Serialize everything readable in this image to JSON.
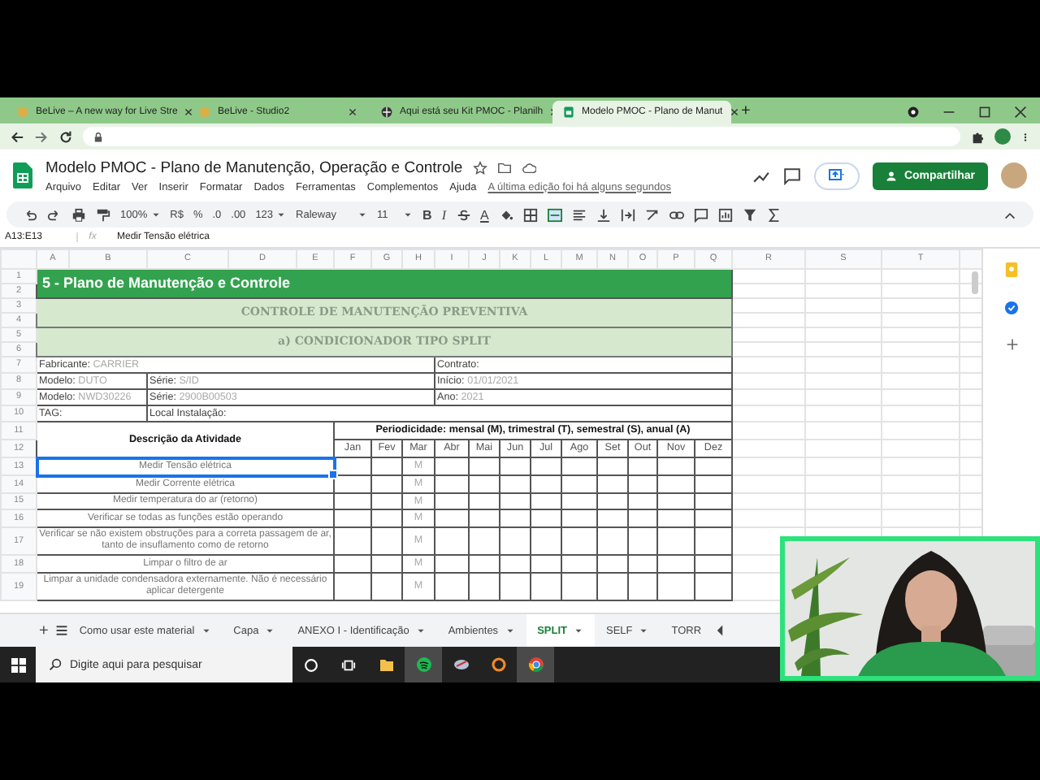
{
  "browser": {
    "tabs": [
      {
        "title": "BeLive – A new way for Live Stre",
        "selected": false
      },
      {
        "title": "BeLive - Studio2",
        "selected": false
      },
      {
        "title": "Aqui está seu Kit PMOC - Planilh",
        "selected": false
      },
      {
        "title": "Modelo PMOC - Plano de Manut",
        "selected": true
      }
    ],
    "new_tab": "+"
  },
  "app": {
    "title": "Modelo PMOC - Plano de Manutenção, Operação e Controle",
    "menu": [
      "Arquivo",
      "Editar",
      "Ver",
      "Inserir",
      "Formatar",
      "Dados",
      "Ferramentas",
      "Complementos",
      "Ajuda"
    ],
    "last_edit": "A última edição foi há alguns segundos",
    "share_button": "Compartilhar"
  },
  "toolbar": {
    "zoom": "100%",
    "currency": "R$",
    "percent": "%",
    "decimal_less": ".0",
    "decimal_more": ".00",
    "number_format": "123",
    "font": "Raleway",
    "font_size": "11",
    "bold": "B",
    "italic": "I",
    "text_color": "A"
  },
  "formula_bar": {
    "range": "A13:E13",
    "fx": "fx",
    "content": "Medir Tensão elétrica"
  },
  "columns": [
    "A",
    "B",
    "C",
    "D",
    "E",
    "F",
    "G",
    "H",
    "I",
    "J",
    "K",
    "L",
    "M",
    "N",
    "O",
    "P",
    "Q",
    "R",
    "S",
    "T"
  ],
  "row_numbers": [
    "1",
    "2",
    "3",
    "4",
    "5",
    "6",
    "7",
    "8",
    "9",
    "10",
    "11",
    "12",
    "13",
    "14",
    "15",
    "16",
    "17",
    "18",
    "19"
  ],
  "sheet": {
    "title": "5 - Plano de Manutenção e Controle",
    "subtitle": "CONTROLE DE MANUTENÇÃO PREVENTIVA",
    "section": "a) CONDICIONADOR TIPO SPLIT",
    "info_rows": [
      [
        {
          "label": "Fabricante:",
          "value": "CARRIER"
        },
        {
          "label": "Contrato:"
        }
      ],
      [
        {
          "label": "Modelo:",
          "value": "DUTO"
        },
        {
          "label": "Série:",
          "value": "S/ID"
        },
        {
          "label": "Início:",
          "value": "01/01/2021"
        }
      ],
      [
        {
          "label": "Modelo:",
          "value": "NWD30226"
        },
        {
          "label": "Série:",
          "value": "2900B00503"
        },
        {
          "label": "Ano:",
          "value": "2021"
        }
      ],
      [
        {
          "label": "TAG:"
        },
        {
          "label": "Local Instalação:"
        }
      ]
    ],
    "activity_header": "Descrição da Atividade",
    "periodicity": "Periodicidade: mensal (M), trimestral (T), semestral (S), anual (A)",
    "months": [
      {
        "label": "Jan"
      },
      {
        "label": "Fev"
      },
      {
        "label": "Mar",
        "marks": [
          "M",
          "M",
          "M",
          "M",
          "M",
          "M",
          "M"
        ]
      },
      {
        "label": "Abr"
      },
      {
        "label": "Mai"
      },
      {
        "label": "Jun"
      },
      {
        "label": "Jul"
      },
      {
        "label": "Ago"
      },
      {
        "label": "Set"
      },
      {
        "label": "Out"
      },
      {
        "label": "Nov"
      },
      {
        "label": "Dez"
      }
    ],
    "activities": [
      {
        "text": "Medir Tensão elétrica",
        "selected": true
      },
      {
        "text": "Medir Corrente elétrica",
        "selected": false
      },
      {
        "text": "Medir temperatura do ar (retorno)",
        "selected": false
      },
      {
        "text": "Verificar se todas as funções estão operando",
        "selected": false
      },
      {
        "text": "Verificar se não existem obstruções para a correta passagem de ar, tanto de insuflamento como de retorno",
        "selected": false
      },
      {
        "text": "Limpar o filtro de ar",
        "selected": false
      },
      {
        "text": "Limpar a unidade condensadora externamente. Não é necessário aplicar detergente",
        "selected": false
      }
    ]
  },
  "sheet_tabs_bar": {
    "add_button": "+"
  },
  "sheet_tabs": [
    {
      "label": "Como usar este material",
      "selected": false,
      "menu_caret": true
    },
    {
      "label": "Capa",
      "selected": false,
      "menu_caret": true
    },
    {
      "label": "ANEXO I - Identificação",
      "selected": false,
      "menu_caret": true
    },
    {
      "label": "Ambientes",
      "selected": false,
      "menu_caret": true
    },
    {
      "label": "SPLIT",
      "selected": true,
      "menu_caret": true
    },
    {
      "label": "SELF",
      "selected": false,
      "menu_caret": true
    },
    {
      "label": "TORR",
      "selected": false,
      "menu_caret": false
    }
  ],
  "taskbar": {
    "search_placeholder": "Digite aqui para pesquisar"
  },
  "webcam": {
    "kind": "picture"
  }
}
